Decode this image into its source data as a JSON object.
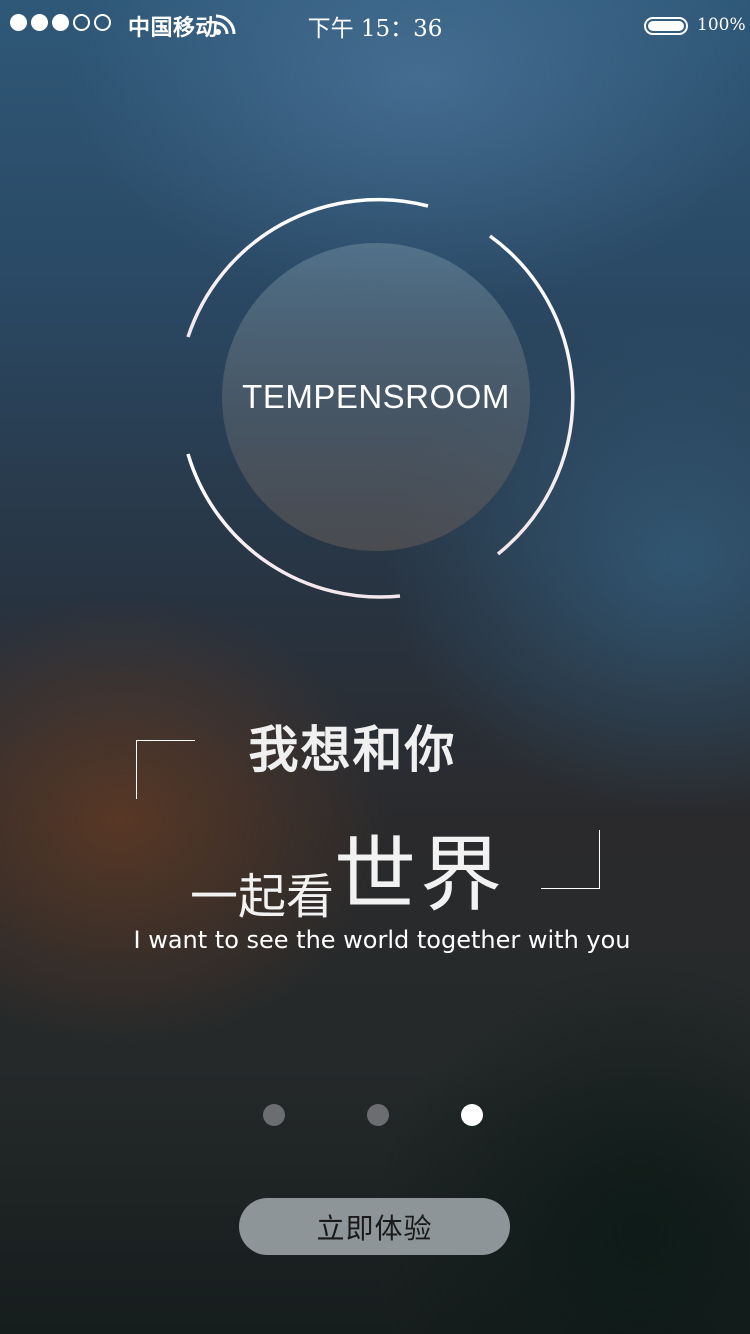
{
  "status_bar": {
    "carrier": "中国移动",
    "time": "下午 15：36",
    "battery_percent": "100%",
    "signal_bars_filled": 3,
    "signal_bars_total": 5
  },
  "logo": {
    "brand_text": "TEMPENSROOM"
  },
  "slogan": {
    "line1": "我想和你",
    "line2_small": "一起看",
    "line2_large": "世界",
    "english": "I want to see the world together with you"
  },
  "pager": {
    "page_count": 3,
    "active_page": 3
  },
  "cta": {
    "label": "立即体验"
  },
  "colors": {
    "accent_white": "#ffffff",
    "cta_background": "#8e9598",
    "pager_inactive": "#6b6d70"
  }
}
